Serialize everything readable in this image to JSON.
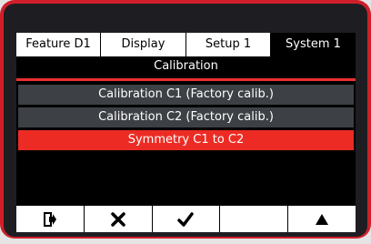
{
  "tabs": [
    {
      "label": "Feature D1",
      "active": false
    },
    {
      "label": "Display",
      "active": false
    },
    {
      "label": "Setup 1",
      "active": false
    },
    {
      "label": "System 1",
      "active": true
    }
  ],
  "header": {
    "title": "Calibration"
  },
  "menu": {
    "items": [
      {
        "label": "Calibration C1 (Factory calib.)",
        "selected": false
      },
      {
        "label": "Calibration C2 (Factory calib.)",
        "selected": false
      },
      {
        "label": "Symmetry C1 to C2",
        "selected": true
      }
    ]
  },
  "softkeys": [
    {
      "icon": "exit-icon"
    },
    {
      "icon": "cancel-x-icon"
    },
    {
      "icon": "confirm-check-icon"
    },
    {
      "icon": ""
    },
    {
      "icon": "up-arrow-icon"
    }
  ],
  "colors": {
    "bezel": "#cf1f2a",
    "accent_red": "#ec2c24",
    "menu_item_bg": "#3d4145",
    "screen_bg": "#000000"
  }
}
